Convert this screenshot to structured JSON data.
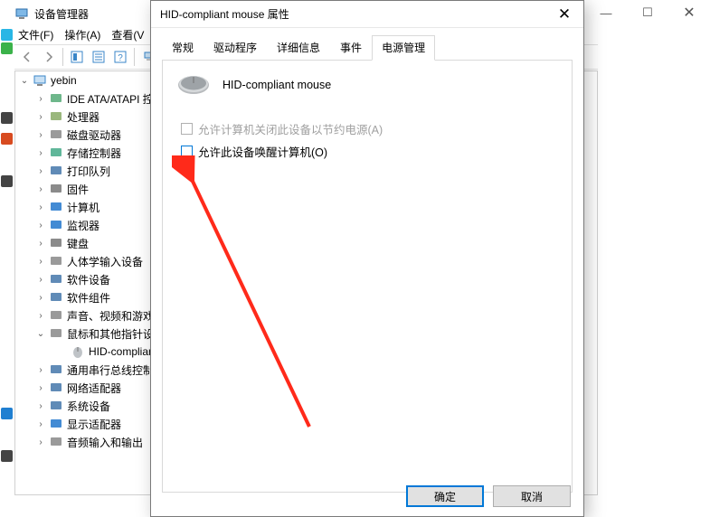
{
  "bg": {
    "title": "设备管理器",
    "menus": {
      "file": "文件(F)",
      "action": "操作(A)",
      "view": "查看(V"
    },
    "tree_root": "yebin",
    "nodes": [
      {
        "label": "IDE ATA/ATAPI 控",
        "expandable": true
      },
      {
        "label": "处理器",
        "expandable": true
      },
      {
        "label": "磁盘驱动器",
        "expandable": true
      },
      {
        "label": "存储控制器",
        "expandable": true
      },
      {
        "label": "打印队列",
        "expandable": true
      },
      {
        "label": "固件",
        "expandable": true
      },
      {
        "label": "计算机",
        "expandable": true
      },
      {
        "label": "监视器",
        "expandable": true
      },
      {
        "label": "键盘",
        "expandable": true
      },
      {
        "label": "人体学输入设备",
        "expandable": true
      },
      {
        "label": "软件设备",
        "expandable": true
      },
      {
        "label": "软件组件",
        "expandable": true
      },
      {
        "label": "声音、视频和游戏",
        "expandable": true
      },
      {
        "label": "鼠标和其他指针设",
        "expandable": true,
        "expanded": true,
        "children": [
          {
            "label": "HID-complian"
          }
        ]
      },
      {
        "label": "通用串行总线控制",
        "expandable": true
      },
      {
        "label": "网络适配器",
        "expandable": true
      },
      {
        "label": "系统设备",
        "expandable": true
      },
      {
        "label": "显示适配器",
        "expandable": true
      },
      {
        "label": "音频输入和输出",
        "expandable": true
      }
    ]
  },
  "dlg": {
    "title": "HID-compliant mouse 属性",
    "tabs": {
      "general": "常规",
      "driver": "驱动程序",
      "details": "详细信息",
      "events": "事件",
      "power": "电源管理"
    },
    "device_name": "HID-compliant mouse",
    "chk1_label": "允许计算机关闭此设备以节约电源(A)",
    "chk2_label": "允许此设备唤醒计算机(O)",
    "btn_ok": "确定",
    "btn_cancel": "取消"
  },
  "winctrl": {
    "min": "—",
    "max": "☐",
    "close": "✕"
  }
}
